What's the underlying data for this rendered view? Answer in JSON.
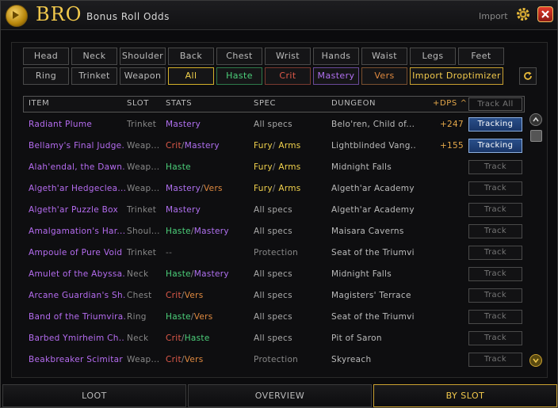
{
  "app": {
    "brand": "BRO",
    "subtitle": "Bonus Roll Odds",
    "import_label": "Import"
  },
  "filters_row1": [
    "Head",
    "Neck",
    "Shoulder",
    "Back",
    "Chest",
    "Wrist",
    "Hands",
    "Waist",
    "Legs",
    "Feet"
  ],
  "filters_row2": [
    {
      "label": "Ring",
      "color": "#bbbbbb",
      "border": "#4a4a4a"
    },
    {
      "label": "Trinket",
      "color": "#bbbbbb",
      "border": "#4a4a4a"
    },
    {
      "label": "Weapon",
      "color": "#bbbbbb",
      "border": "#4a4a4a"
    },
    {
      "label": "All",
      "color": "#f2d24c",
      "border": "#d4b02a"
    },
    {
      "label": "Haste",
      "color": "#4ccf7a",
      "border": "#2f7a4a"
    },
    {
      "label": "Crit",
      "color": "#e05a4a",
      "border": "#7a3a30"
    },
    {
      "label": "Mastery",
      "color": "#b070f0",
      "border": "#6a4a9a"
    },
    {
      "label": "Vers",
      "color": "#e08a40",
      "border": "#7a5030"
    },
    {
      "label": "Import Droptimizer",
      "color": "#f2c94c",
      "border": "#c9a030"
    }
  ],
  "table": {
    "headers": {
      "item": "ITEM",
      "slot": "SLOT",
      "stats": "STATS",
      "spec": "SPEC",
      "dungeon": "DUNGEON",
      "dps": "+DPS ^"
    },
    "track_all": "Track All",
    "rows": [
      {
        "item": "Radiant Plume",
        "slot": "Trinket",
        "stats": [
          {
            "t": "Mastery",
            "c": "#b070f0"
          }
        ],
        "spec": [
          {
            "t": "All specs",
            "c": "#aaaaaa"
          }
        ],
        "dungeon": "Belo'ren, Child of...",
        "dps": "+247",
        "track": "Tracking",
        "tracked": true
      },
      {
        "item": "Bellamy's Final Judge...",
        "slot": "Weap...",
        "stats": [
          {
            "t": "Crit",
            "c": "#e05a4a"
          },
          {
            "t": "/",
            "c": "#888888"
          },
          {
            "t": "Mastery",
            "c": "#b070f0"
          }
        ],
        "spec": [
          {
            "t": "Fury",
            "c": "#f2d24c"
          },
          {
            "t": "/ ",
            "c": "#888888"
          },
          {
            "t": "Arms",
            "c": "#f2d24c"
          }
        ],
        "dungeon": "Lightblinded Vang...",
        "dps": "+155",
        "track": "Tracking",
        "tracked": true
      },
      {
        "item": "Alah'endal, the Dawn...",
        "slot": "Weap...",
        "stats": [
          {
            "t": "Haste",
            "c": "#4ccf7a"
          }
        ],
        "spec": [
          {
            "t": "Fury",
            "c": "#f2d24c"
          },
          {
            "t": "/ ",
            "c": "#888888"
          },
          {
            "t": "Arms",
            "c": "#f2d24c"
          }
        ],
        "dungeon": "Midnight Falls",
        "dps": "",
        "track": "Track",
        "tracked": false
      },
      {
        "item": "Algeth'ar Hedgeclea...",
        "slot": "Weap...",
        "stats": [
          {
            "t": "Mastery",
            "c": "#b070f0"
          },
          {
            "t": "/",
            "c": "#888888"
          },
          {
            "t": "Vers",
            "c": "#e08a40"
          }
        ],
        "spec": [
          {
            "t": "Fury",
            "c": "#f2d24c"
          },
          {
            "t": "/ ",
            "c": "#888888"
          },
          {
            "t": "Arms",
            "c": "#f2d24c"
          }
        ],
        "dungeon": "Algeth'ar Academy",
        "dps": "",
        "track": "Track",
        "tracked": false
      },
      {
        "item": "Algeth'ar Puzzle Box",
        "slot": "Trinket",
        "stats": [
          {
            "t": "Mastery",
            "c": "#b070f0"
          }
        ],
        "spec": [
          {
            "t": "All specs",
            "c": "#aaaaaa"
          }
        ],
        "dungeon": "Algeth'ar Academy",
        "dps": "",
        "track": "Track",
        "tracked": false
      },
      {
        "item": "Amalgamation's Har...",
        "slot": "Shoul...",
        "stats": [
          {
            "t": "Haste",
            "c": "#4ccf7a"
          },
          {
            "t": "/",
            "c": "#888888"
          },
          {
            "t": "Mastery",
            "c": "#b070f0"
          }
        ],
        "spec": [
          {
            "t": "All specs",
            "c": "#aaaaaa"
          }
        ],
        "dungeon": "Maisara Caverns",
        "dps": "",
        "track": "Track",
        "tracked": false
      },
      {
        "item": "Ampoule of Pure Void",
        "slot": "Trinket",
        "stats": [
          {
            "t": "--",
            "c": "#777777"
          }
        ],
        "spec": [
          {
            "t": "Protection",
            "c": "#888888"
          }
        ],
        "dungeon": "Seat of the Triumvi...",
        "dps": "",
        "track": "Track",
        "tracked": false
      },
      {
        "item": "Amulet of the Abyssa...",
        "slot": "Neck",
        "stats": [
          {
            "t": "Haste",
            "c": "#4ccf7a"
          },
          {
            "t": "/",
            "c": "#888888"
          },
          {
            "t": "Mastery",
            "c": "#b070f0"
          }
        ],
        "spec": [
          {
            "t": "All specs",
            "c": "#aaaaaa"
          }
        ],
        "dungeon": "Midnight Falls",
        "dps": "",
        "track": "Track",
        "tracked": false
      },
      {
        "item": "Arcane Guardian's Sh...",
        "slot": "Chest",
        "stats": [
          {
            "t": "Crit",
            "c": "#e05a4a"
          },
          {
            "t": "/",
            "c": "#888888"
          },
          {
            "t": "Vers",
            "c": "#e08a40"
          }
        ],
        "spec": [
          {
            "t": "All specs",
            "c": "#aaaaaa"
          }
        ],
        "dungeon": "Magisters' Terrace",
        "dps": "",
        "track": "Track",
        "tracked": false
      },
      {
        "item": "Band of the Triumvira...",
        "slot": "Ring",
        "stats": [
          {
            "t": "Haste",
            "c": "#4ccf7a"
          },
          {
            "t": "/",
            "c": "#888888"
          },
          {
            "t": "Vers",
            "c": "#e08a40"
          }
        ],
        "spec": [
          {
            "t": "All specs",
            "c": "#aaaaaa"
          }
        ],
        "dungeon": "Seat of the Triumvi...",
        "dps": "",
        "track": "Track",
        "tracked": false
      },
      {
        "item": "Barbed Ymirheim Ch...",
        "slot": "Neck",
        "stats": [
          {
            "t": "Crit",
            "c": "#e05a4a"
          },
          {
            "t": "/",
            "c": "#888888"
          },
          {
            "t": "Haste",
            "c": "#4ccf7a"
          }
        ],
        "spec": [
          {
            "t": "All specs",
            "c": "#aaaaaa"
          }
        ],
        "dungeon": "Pit of Saron",
        "dps": "",
        "track": "Track",
        "tracked": false
      },
      {
        "item": "Beakbreaker Scimitar",
        "slot": "Weap...",
        "stats": [
          {
            "t": "Crit",
            "c": "#e05a4a"
          },
          {
            "t": "/",
            "c": "#888888"
          },
          {
            "t": "Vers",
            "c": "#e08a40"
          }
        ],
        "spec": [
          {
            "t": "Protection",
            "c": "#888888"
          }
        ],
        "dungeon": "Skyreach",
        "dps": "",
        "track": "Track",
        "tracked": false
      }
    ]
  },
  "tabs": [
    {
      "label": "LOOT",
      "active": false
    },
    {
      "label": "OVERVIEW",
      "active": false
    },
    {
      "label": "BY SLOT",
      "active": true
    }
  ],
  "colors": {
    "accent": "#f2c94c",
    "item": "#b56cf0",
    "tracked": "#1a3668"
  }
}
